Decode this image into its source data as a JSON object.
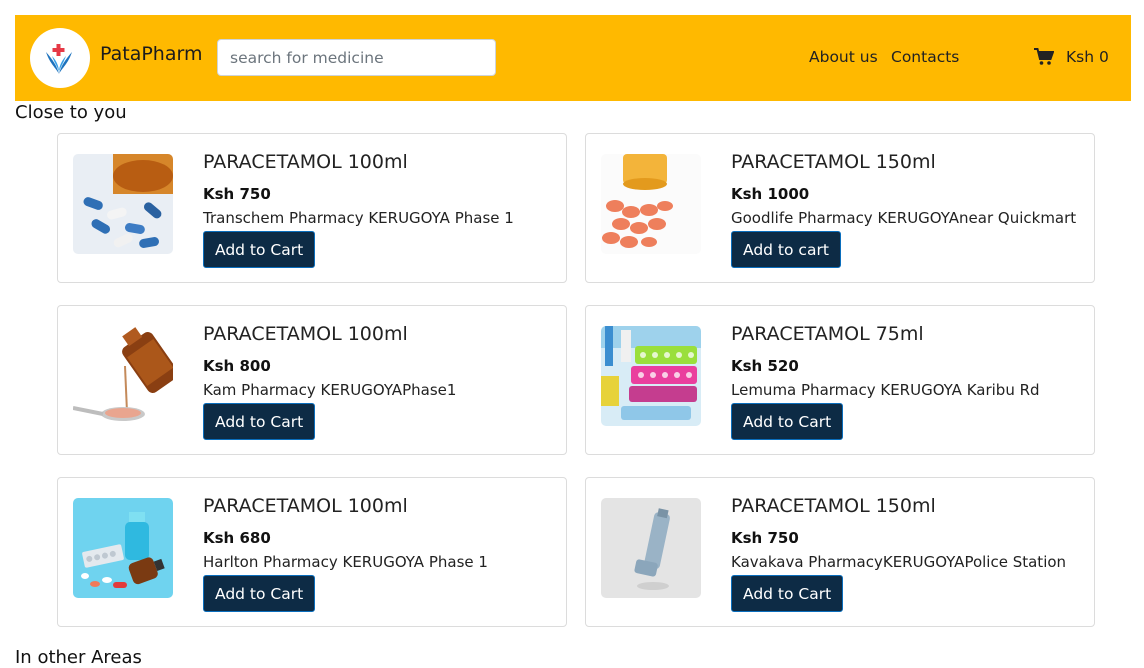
{
  "header": {
    "brand": "PataPharm",
    "search_placeholder": "search for medicine",
    "nav": [
      "About us",
      "Contacts"
    ],
    "cart_total": "Ksh 0",
    "accent_color": "#ffb900",
    "logo_icon": "caduceus-cross-logo",
    "cart_icon": "shopping-cart-icon"
  },
  "sections": {
    "close": "Close to you",
    "other": "In other Areas"
  },
  "products": [
    {
      "name": "PARACETAMOL 100ml",
      "price": "Ksh 750",
      "store": "Transchem Pharmacy KERUGOYA Phase 1",
      "button": "Add to Cart",
      "image": "blue-white-capsules"
    },
    {
      "name": "PARACETAMOL 150ml",
      "price": "Ksh 1000",
      "store": "Goodlife Pharmacy KERUGOYAnear Quickmart",
      "button": "Add to cart",
      "image": "orange-tablets-spilled"
    },
    {
      "name": "PARACETAMOL 100ml",
      "price": "Ksh 800",
      "store": "Kam Pharmacy KERUGOYAPhase1",
      "button": "Add to Cart",
      "image": "syrup-bottle-spoon"
    },
    {
      "name": "PARACETAMOL 75ml",
      "price": "Ksh 520",
      "store": "Lemuma Pharmacy KERUGOYA Karibu Rd",
      "button": "Add to Cart",
      "image": "colorful-blister-packs"
    },
    {
      "name": "PARACETAMOL 100ml",
      "price": "Ksh 680",
      "store": "Harlton Pharmacy KERUGOYA Phase 1",
      "button": "Add to Cart",
      "image": "vials-and-pills-blue"
    },
    {
      "name": "PARACETAMOL 150ml",
      "price": "Ksh 750",
      "store": "Kavakava PharmacyKERUGOYAPolice Station",
      "button": "Add to Cart",
      "image": "inhaler"
    }
  ]
}
